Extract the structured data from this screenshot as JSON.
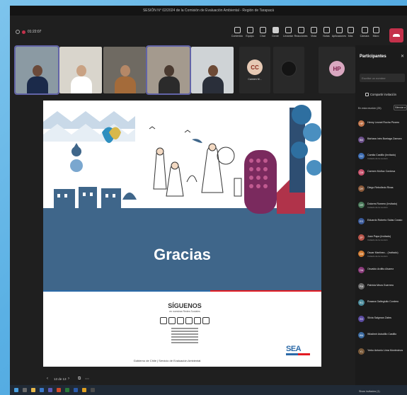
{
  "window": {
    "title": "SESIÓN N° 02/2024 de la Comisión de Evaluación Ambiental - Región de Tarapacá"
  },
  "meeting": {
    "elapsed": "01:22:07"
  },
  "toolbar": {
    "buttons": [
      {
        "id": "contenido",
        "label": "Contenido",
        "icon": "screen-share-icon"
      },
      {
        "id": "equipo",
        "label": "Equipo",
        "icon": "people-icon"
      },
      {
        "id": "chat",
        "label": "Chat",
        "icon": "chat-icon"
      },
      {
        "id": "gente",
        "label": "Gente",
        "icon": "participants-icon"
      },
      {
        "id": "levantar",
        "label": "Levantar",
        "icon": "raise-hand-icon"
      },
      {
        "id": "reacciones",
        "label": "Reacciones",
        "icon": "emoji-icon"
      },
      {
        "id": "vista",
        "label": "Vista",
        "icon": "view-icon"
      },
      {
        "id": "notas",
        "label": "Notas",
        "icon": "notes-icon"
      },
      {
        "id": "aplicaciones",
        "label": "Aplicaciones",
        "icon": "apps-icon"
      },
      {
        "id": "mas",
        "label": "Más",
        "icon": "more-icon"
      },
      {
        "id": "camara",
        "label": "Cámara",
        "icon": "camera-icon"
      },
      {
        "id": "micro",
        "label": "Micro",
        "icon": "mic-icon"
      },
      {
        "id": "compartir",
        "label": "Compartir",
        "icon": "share-tray-icon"
      }
    ],
    "leave_color": "#c4314b"
  },
  "videos": [
    {
      "kind": "video",
      "skin": "#6b4a3a",
      "shirt": "#1b2a4a",
      "bg": "#8b9aa3"
    },
    {
      "kind": "video",
      "skin": "#c9a283",
      "shirt": "#ffffff",
      "bg": "#d9d5cc"
    },
    {
      "kind": "video",
      "skin": "#b58867",
      "shirt": "#a46b3a",
      "bg": "#6f6a62"
    },
    {
      "kind": "video",
      "skin": "#4a3a30",
      "shirt": "#2b2b2b",
      "bg": "#a49a8e"
    },
    {
      "kind": "video",
      "skin": "#6d4a36",
      "shirt": "#2a2f3a",
      "bg": "#cfd3d6"
    }
  ],
  "tiles": [
    {
      "initials": "CC",
      "name": "Carmen M... ",
      "color": "#e6c9b4",
      "fg": "#8a2c1c"
    },
    {
      "initials": "",
      "name": "",
      "color": "#141414",
      "fg": "#444"
    },
    {
      "initials": "HP",
      "name": "",
      "color": "#d9a7c0",
      "fg": "#7a1d48"
    }
  ],
  "slide": {
    "title": "Gracias",
    "follow_heading": "SÍGUENOS",
    "follow_sub": "en nuestras Redes Sociales",
    "footer": "Gobierno de Chile | Servicio de Evaluación Ambiental",
    "logo_text": "SEA",
    "band_color": "#3f668a"
  },
  "pager": {
    "page": "13 de 13"
  },
  "panel": {
    "title": "Participantes",
    "search_placeholder": "Escribe un nombre",
    "share_label": "Compartir invitación",
    "section_label": "En esta reunión (25)",
    "mute_all_label": "Silenciar a todos",
    "show_invited": "Show invitados (1)",
    "participants": [
      {
        "name": "Henry Leonel Rocha Pizarro",
        "role": "",
        "color": "#c0744a",
        "initials": "HP"
      },
      {
        "name": "Bárbara Inés Burriaga Zamora",
        "role": "",
        "color": "#6b4f8a",
        "initials": "BB"
      },
      {
        "name": "Camila Castillo (Invitado)",
        "role": "Invitado de la reunión",
        "color": "#3d6db3",
        "initials": "CC"
      },
      {
        "name": "Carmen Muñoz Cordova",
        "role": "",
        "color": "#c64f6a",
        "initials": "CM"
      },
      {
        "name": "Diego Rebolledo Rivas",
        "role": "",
        "color": "#8c5a3a",
        "initials": "DR"
      },
      {
        "name": "Dolores Romero (Invitado)",
        "role": "Invitado de la reunión",
        "color": "#4a7a5a",
        "initials": "DR"
      },
      {
        "name": "Eduardo Roberto Salas Cossio",
        "role": "",
        "color": "#3a5a9a",
        "initials": "ES"
      },
      {
        "name": "Juan Papa (Invitado)",
        "role": "Invitado de la reunión",
        "color": "#b8554a",
        "initials": "JP"
      },
      {
        "name": "Oscar Martínez... (Invitado)",
        "role": "Invitado de la reunión",
        "color": "#d07a30",
        "initials": "OM"
      },
      {
        "name": "Osvaldo Arditto Alvarez",
        "role": "",
        "color": "#8a3a7a",
        "initials": "OA"
      },
      {
        "name": "Patricia Meza Guerrero",
        "role": "",
        "color": "#6a6a6a",
        "initials": "PM"
      },
      {
        "name": "Rosana Gallegiullo Cordero",
        "role": "",
        "color": "#4a8a9a",
        "initials": "RG"
      },
      {
        "name": "Silvia Salgman Zabrs",
        "role": "",
        "color": "#5a4aa0",
        "initials": "SS"
      },
      {
        "name": "Wladimir Astudillo Castillo",
        "role": "",
        "color": "#3a6aa0",
        "initials": "WA"
      },
      {
        "name": "Yerko Antonio Lima Montecinos",
        "role": "",
        "color": "#7a5a3a",
        "initials": "YL"
      }
    ]
  }
}
